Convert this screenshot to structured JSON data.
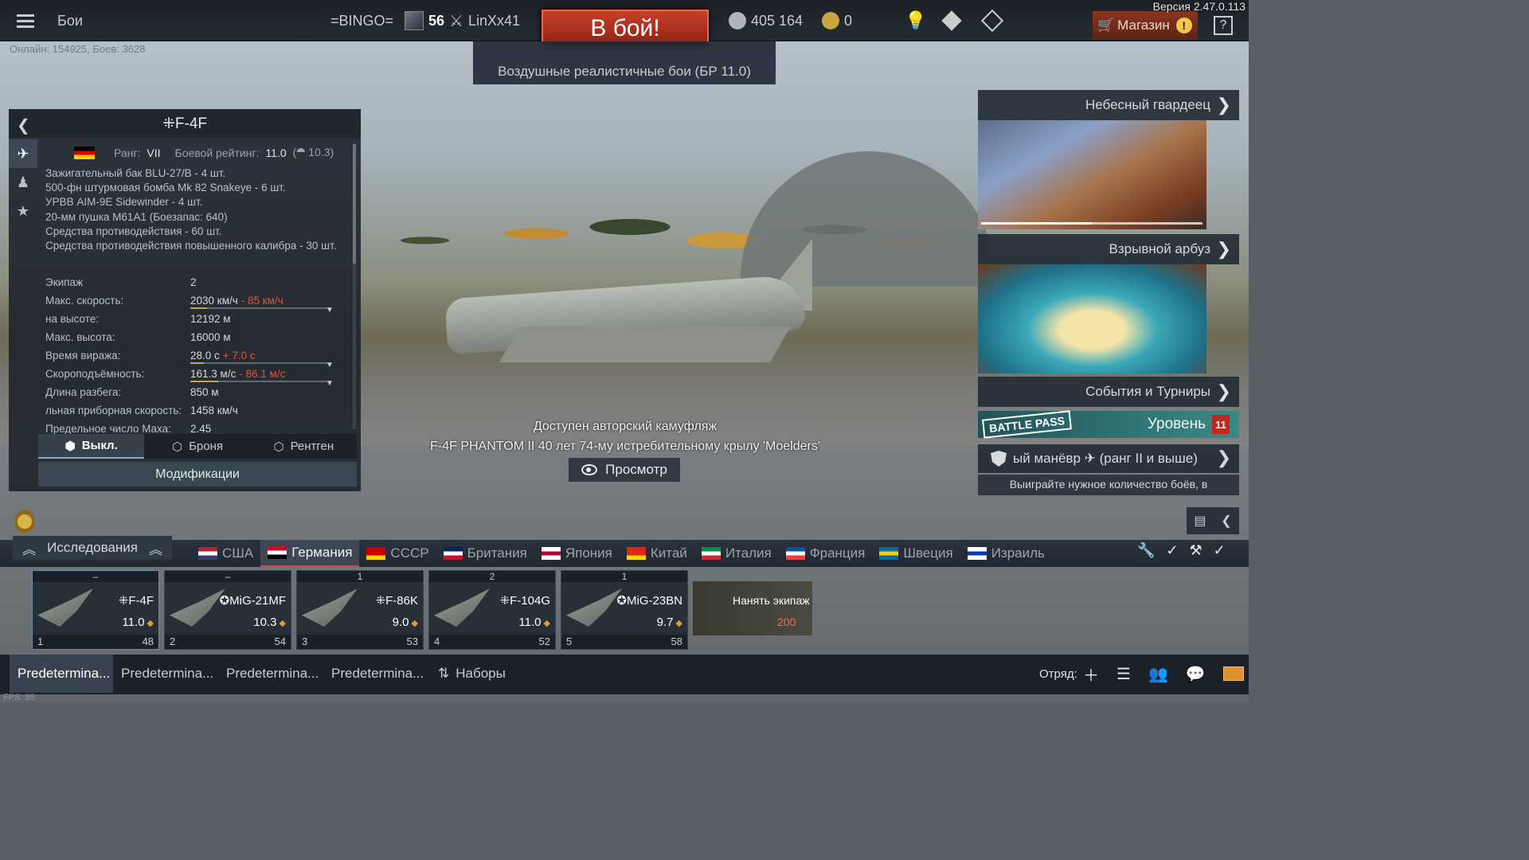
{
  "app": {
    "version": "Версия 2.47.0.113",
    "online": "Онлайн: 154925, Боев: 3628",
    "fps": "FPS: 35"
  },
  "topbar": {
    "menu_label": "Бои",
    "squad_tag": "=BINGO=",
    "player_level": "56",
    "player_name": "LinXx41",
    "to_battle": "В бой!",
    "lions": "405 164",
    "eagles": "0",
    "shop": "Магазин",
    "shop_alert": "!",
    "help": "?"
  },
  "mode": "Воздушные реалистичные бои (БР 11.0)",
  "vehicle": {
    "title": "⁜F-4F",
    "rank_label": "Ранг:",
    "rank": "VII",
    "br_label": "Боевой рейтинг:",
    "br": "11.0",
    "br_alt": "(⯊ 10.3)",
    "weapons": [
      "Зажигательный бак BLU-27/B - 4 шт.",
      "500-фн штурмовая бомба Mk 82 Snakeye - 6 шт.",
      "УРВВ AIM-9E Sidewinder - 4 шт.",
      "20-мм пушка M61A1 (Боезапас: 640)",
      "Средства противодействия - 60 шт.",
      "Средства противодействия повышенного калибра - 30 шт."
    ],
    "stats": [
      {
        "k": "Экипаж",
        "v": "2",
        "d": "",
        "fill": null
      },
      {
        "k": "Макс. скорость:",
        "v": "2030 км/ч",
        "d": "- 85 км/ч",
        "fill": 0.12
      },
      {
        "k": "на высоте:",
        "v": "12192 м",
        "d": "",
        "fill": null
      },
      {
        "k": "Макс. высота:",
        "v": "16000 м",
        "d": "",
        "fill": null
      },
      {
        "k": "Время виража:",
        "v": "28.0 с",
        "d": "+ 7.0 с",
        "fill": 0.1
      },
      {
        "k": "Скороподъёмность:",
        "v": "161.3 м/с",
        "d": "- 86.1 м/с",
        "fill": 0.2
      },
      {
        "k": "Длина разбега:",
        "v": "850 м",
        "d": "",
        "fill": null
      },
      {
        "k": "льная приборная скорость:",
        "v": "1458 км/ч",
        "d": "",
        "fill": null
      },
      {
        "k": "Предельное число Маха:",
        "v": "2.45",
        "d": "",
        "fill": null
      }
    ],
    "view_tabs": [
      "Выкл.",
      "Броня",
      "Рентген"
    ],
    "modifications": "Модификации"
  },
  "camo": {
    "line1": "Доступен авторский камуфляж",
    "line2": "F-4F PHANTOM II 40 лет 74-му истребительному крылу 'Moelders'",
    "preview": "Просмотр"
  },
  "events": {
    "items": [
      "Небесный гвардеец",
      "Взрывной арбуз",
      "События и Турниры"
    ],
    "battlepass_logo": "BATTLE PASS",
    "battlepass_level_label": "Уровень",
    "battlepass_level": "11",
    "task_title": "ый манёвр ✈ (ранг II и выше)",
    "task_desc": "Выиграйте нужное количество боёв, в"
  },
  "research": "Исследования",
  "nations": [
    {
      "name": "США",
      "colors": [
        "#b22234",
        "#ffffff",
        "#3c3b6e"
      ]
    },
    {
      "name": "Германия",
      "colors": [
        "#c8102e",
        "#ffffff",
        "#000000"
      ]
    },
    {
      "name": "СССР",
      "colors": [
        "#cc0000",
        "#cc0000",
        "#ffd700"
      ]
    },
    {
      "name": "Британия",
      "colors": [
        "#012169",
        "#ffffff",
        "#c8102e"
      ]
    },
    {
      "name": "Япония",
      "colors": [
        "#ffffff",
        "#bc002d",
        "#ffffff"
      ]
    },
    {
      "name": "Китай",
      "colors": [
        "#de2910",
        "#de2910",
        "#ffde00"
      ]
    },
    {
      "name": "Италия",
      "colors": [
        "#009246",
        "#ffffff",
        "#ce2b37"
      ]
    },
    {
      "name": "Франция",
      "colors": [
        "#0055a4",
        "#ffffff",
        "#ef4135"
      ]
    },
    {
      "name": "Швеция",
      "colors": [
        "#006aa7",
        "#fecc00",
        "#006aa7"
      ]
    },
    {
      "name": "Израиль",
      "colors": [
        "#ffffff",
        "#0038b8",
        "#ffffff"
      ]
    }
  ],
  "active_nation": "Германия",
  "slots": [
    {
      "cost": "–",
      "name": "⁜F-4F",
      "br": "11.0",
      "crew": "1",
      "lvl": "48"
    },
    {
      "cost": "–",
      "name": "✪MiG-21MF",
      "br": "10.3",
      "crew": "2",
      "lvl": "54"
    },
    {
      "cost": "1",
      "name": "⁜F-86K",
      "br": "9.0",
      "crew": "3",
      "lvl": "53"
    },
    {
      "cost": "2",
      "name": "⁜F-104G",
      "br": "11.0",
      "crew": "4",
      "lvl": "52"
    },
    {
      "cost": "1",
      "name": "✪MiG-23BN",
      "br": "9.7",
      "crew": "5",
      "lvl": "58"
    }
  ],
  "hire": {
    "label": "Нанять экипаж",
    "price": "200"
  },
  "presets": [
    "Predetermina...",
    "Predetermina...",
    "Predetermina...",
    "Predetermina..."
  ],
  "sets": "Наборы",
  "squad_label": "Отряд:",
  "accent": "#c8513a"
}
